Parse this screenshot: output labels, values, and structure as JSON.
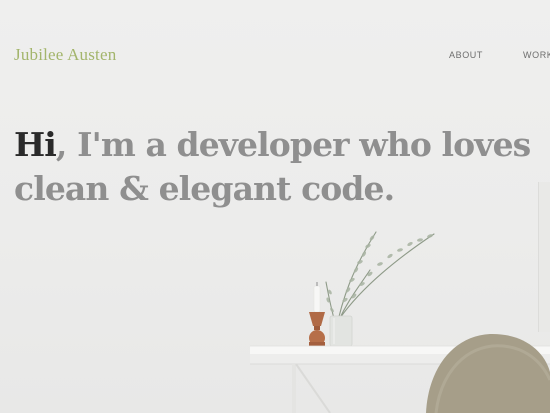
{
  "header": {
    "brand": "Jubilee Austen",
    "nav": [
      {
        "label": "ABOUT"
      },
      {
        "label": "WORK"
      }
    ]
  },
  "hero": {
    "greeting": "Hi",
    "line1_rest": ", I'm a developer who loves",
    "line2": "clean & elegant code."
  },
  "colors": {
    "brand": "#a3b56c",
    "greeting": "#2a2a2a",
    "headline": "#8f8f8f",
    "background": "#ececeb"
  }
}
